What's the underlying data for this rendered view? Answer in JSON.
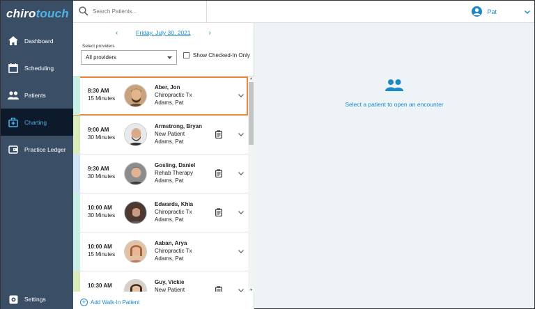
{
  "app": {
    "logo_part1": "chiro",
    "logo_part2": "touch"
  },
  "sidebar": {
    "items": [
      {
        "label": "Dashboard",
        "icon": "home-icon"
      },
      {
        "label": "Scheduling",
        "icon": "calendar-icon"
      },
      {
        "label": "Patients",
        "icon": "people-icon"
      },
      {
        "label": "Charting",
        "icon": "medical-bag-icon",
        "active": true
      },
      {
        "label": "Practice Ledger",
        "icon": "wallet-icon"
      }
    ],
    "settings_label": "Settings"
  },
  "search": {
    "placeholder": "Search Patients..."
  },
  "user": {
    "name": "Pat"
  },
  "schedule": {
    "date": "Friday, July 30, 2021",
    "providers_label": "Select providers",
    "providers_value": "All providers",
    "checked_in_label": "Show Checked-In Only",
    "walkin_label": "Add Walk-In Patient"
  },
  "appointments": [
    {
      "time": "8:30 AM",
      "duration": "15 Minutes",
      "name": "Aber, Jon",
      "type": "Chiropractic Tx",
      "provider": "Adams, Pat",
      "status_color": "#c8f0e4",
      "clipboard": false,
      "selected": true
    },
    {
      "time": "9:00 AM",
      "duration": "30 Minutes",
      "name": "Armstrong, Bryan",
      "type": "New Patient",
      "provider": "Adams, Pat",
      "status_color": "#d7ecb8",
      "clipboard": true
    },
    {
      "time": "9:30 AM",
      "duration": "30 Minutes",
      "name": "Gosling, Daniel",
      "type": "Rehab Therapy",
      "provider": "Adams, Pat",
      "status_color": "#cfe5f7",
      "clipboard": true
    },
    {
      "time": "10:00 AM",
      "duration": "30 Minutes",
      "name": "Edwards, Khia",
      "type": "Chiropractic Tx",
      "provider": "Adams, Pat",
      "status_color": "#c8f0e4",
      "clipboard": true
    },
    {
      "time": "10:00 AM",
      "duration": "15 Minutes",
      "name": "Aaban, Arya",
      "type": "Chiropractic Tx",
      "provider": "Adams, Pat",
      "status_color": "#c8f0e4",
      "clipboard": false
    },
    {
      "time": "10:30 AM",
      "duration": "",
      "name": "Guy, Vickie",
      "type": "New Patient",
      "provider": "",
      "status_color": "#d7ecb8",
      "clipboard": true
    }
  ],
  "encounter": {
    "empty_message": "Select a patient to open an encounter"
  },
  "colors": {
    "sidebar_bg": "#3a4f66",
    "accent": "#1c88c7",
    "selected_outline": "#e88a3c"
  }
}
